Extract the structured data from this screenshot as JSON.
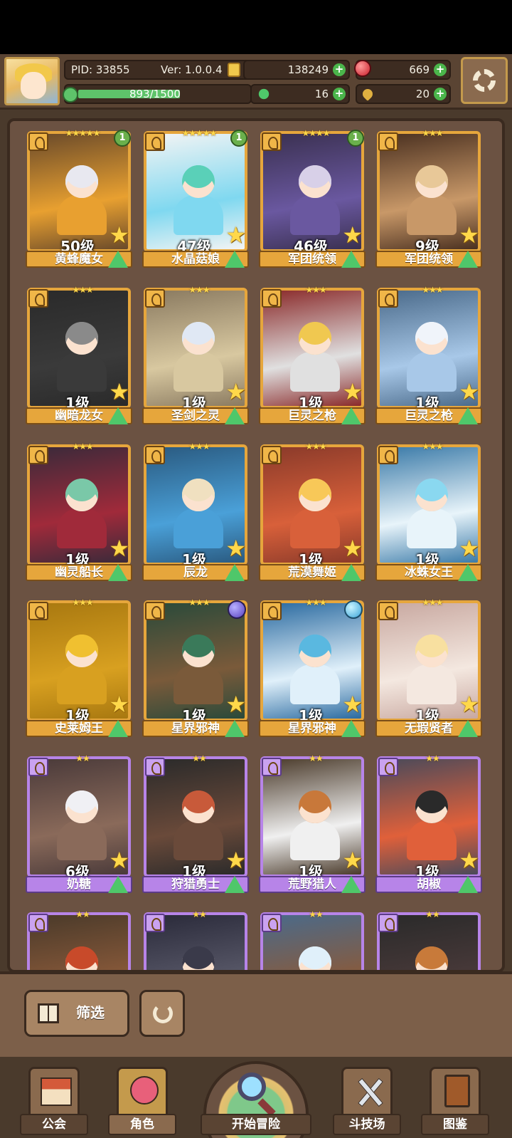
{
  "hud": {
    "pid": "PID: 33855",
    "version": "Ver: 1.0.0.4",
    "gold": "138249",
    "gems": "669",
    "exp_text": "893/1500",
    "exp_fraction": 0.595,
    "clover": "16",
    "keys": "20"
  },
  "cards": [
    {
      "name": "黄蜂魔女",
      "level": "50级",
      "stars": "★★★★★",
      "rarity": "gold",
      "badge": "1",
      "colors": [
        "#e8e8f0",
        "#e8a030",
        "#6a4a2a"
      ]
    },
    {
      "name": "水晶菇娘",
      "level": "47级",
      "stars": "★★★★★",
      "rarity": "gold",
      "badge": "1",
      "colors": [
        "#5ad0b8",
        "#7fd8f0",
        "#f4f4f4"
      ]
    },
    {
      "name": "军团统领",
      "level": "46级",
      "stars": "★★★★",
      "rarity": "gold",
      "badge": "1",
      "colors": [
        "#d8d0e8",
        "#6a58a0",
        "#3a3050"
      ]
    },
    {
      "name": "军团统领",
      "level": "9级",
      "stars": "★★★",
      "rarity": "gold",
      "badge": "",
      "colors": [
        "#e8c898",
        "#c89868",
        "#4a3020"
      ]
    },
    {
      "name": "幽暗龙女",
      "level": "1级",
      "stars": "★★★",
      "rarity": "gold",
      "badge": "",
      "colors": [
        "#8a8a8a",
        "#3a3a3a",
        "#2a2a2a"
      ]
    },
    {
      "name": "圣剑之灵",
      "level": "1级",
      "stars": "★★★",
      "rarity": "gold",
      "badge": "",
      "colors": [
        "#e0e8f4",
        "#d8c8a0",
        "#8a7a60"
      ]
    },
    {
      "name": "巨灵之枪",
      "level": "1级",
      "stars": "★★★",
      "rarity": "gold",
      "badge": "",
      "colors": [
        "#f0c850",
        "#e0e0e0",
        "#8a2a2a"
      ]
    },
    {
      "name": "巨灵之枪",
      "level": "1级",
      "stars": "★★★",
      "rarity": "gold",
      "badge": "",
      "colors": [
        "#f0f4fa",
        "#a8c8e8",
        "#4a6a8a"
      ]
    },
    {
      "name": "幽灵船长",
      "level": "1级",
      "stars": "★★★",
      "rarity": "gold",
      "badge": "",
      "colors": [
        "#7ac8a8",
        "#a02a3a",
        "#3a2a3a"
      ]
    },
    {
      "name": "辰龙",
      "level": "1级",
      "stars": "★★★",
      "rarity": "gold",
      "badge": "",
      "colors": [
        "#f0e0c0",
        "#4aa0d8",
        "#2a5a80"
      ]
    },
    {
      "name": "荒漠舞姬",
      "level": "1级",
      "stars": "★★★",
      "rarity": "gold",
      "badge": "",
      "colors": [
        "#f8c858",
        "#d8603a",
        "#8a3a2a"
      ]
    },
    {
      "name": "冰蛛女王",
      "level": "1级",
      "stars": "★★★",
      "rarity": "gold",
      "badge": "",
      "colors": [
        "#8ad8f0",
        "#e8f4fa",
        "#3a7aa8"
      ]
    },
    {
      "name": "史莱姆王",
      "level": "1级",
      "stars": "★★★",
      "rarity": "gold",
      "badge": "",
      "colors": [
        "#f0c030",
        "#d8a020",
        "#a87810"
      ]
    },
    {
      "name": "星界邪神",
      "level": "1级",
      "stars": "★★★",
      "rarity": "gold",
      "badge": "",
      "orb": "purple",
      "colors": [
        "#3a7a5a",
        "#7a5a3a",
        "#2a4a3a"
      ]
    },
    {
      "name": "星界邪神",
      "level": "1级",
      "stars": "★★★",
      "rarity": "gold",
      "badge": "",
      "orb": "blue",
      "colors": [
        "#5ab8e0",
        "#e0f0fa",
        "#2a6aa0"
      ]
    },
    {
      "name": "无瑕贤者",
      "level": "1级",
      "stars": "★★★",
      "rarity": "gold",
      "badge": "",
      "colors": [
        "#f8e0a0",
        "#f4e8e0",
        "#c8a8a0"
      ]
    },
    {
      "name": "奶糖",
      "level": "6级",
      "stars": "★★",
      "rarity": "purple",
      "badge": "",
      "colors": [
        "#f0f0f4",
        "#8a6a5a",
        "#4a3a3a"
      ]
    },
    {
      "name": "狩猎勇士",
      "level": "1级",
      "stars": "★★",
      "rarity": "purple",
      "badge": "",
      "colors": [
        "#c85a3a",
        "#6a4a3a",
        "#2a2a2a"
      ]
    },
    {
      "name": "荒野猎人",
      "level": "1级",
      "stars": "★★",
      "rarity": "purple",
      "badge": "",
      "colors": [
        "#c8783a",
        "#f0f0f0",
        "#4a3a2a"
      ]
    },
    {
      "name": "胡椒",
      "level": "1级",
      "stars": "★★",
      "rarity": "purple",
      "badge": "",
      "colors": [
        "#2a2a2a",
        "#e0603a",
        "#4a4a5a"
      ]
    },
    {
      "name": "",
      "level": "",
      "stars": "★★",
      "rarity": "purple",
      "badge": "",
      "colors": [
        "#c84a2a",
        "#8a5a3a",
        "#4a3a2a"
      ]
    },
    {
      "name": "",
      "level": "",
      "stars": "★★",
      "rarity": "purple",
      "badge": "",
      "colors": [
        "#3a3a4a",
        "#5a5a6a",
        "#2a2a3a"
      ]
    },
    {
      "name": "",
      "level": "",
      "stars": "★★",
      "rarity": "purple",
      "badge": "",
      "colors": [
        "#e0f0fa",
        "#8a5a3a",
        "#4a6a8a"
      ]
    },
    {
      "name": "",
      "level": "",
      "stars": "★★",
      "rarity": "purple",
      "badge": "",
      "colors": [
        "#c87a3a",
        "#4a3a3a",
        "#2a2a2a"
      ]
    }
  ],
  "toolbar": {
    "filter_label": "筛选"
  },
  "nav": {
    "guild": "公会",
    "role": "角色",
    "adventure": "开始冒险",
    "arena": "斗技场",
    "codex": "图鉴"
  }
}
